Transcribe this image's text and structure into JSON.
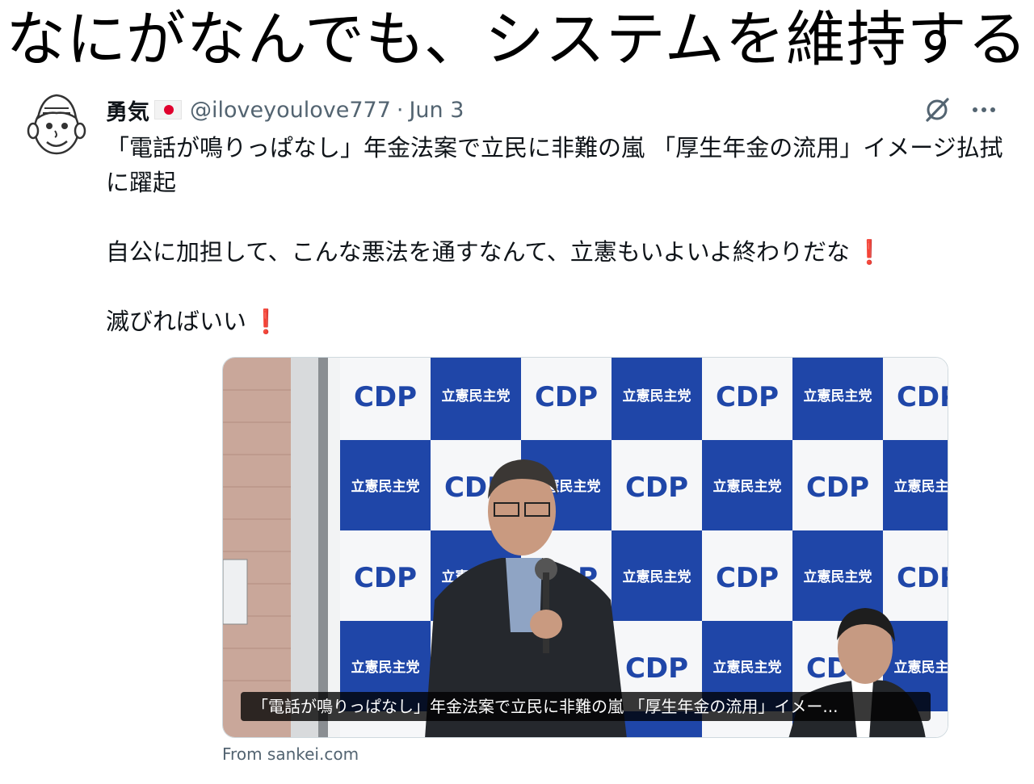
{
  "banner": {
    "title": "なにがなんでも、システムを維持する"
  },
  "tweet": {
    "display_name": "勇気",
    "handle": "@iloveyoulove777",
    "separator": "·",
    "date": "Jun 3",
    "text_line1": "「電話が鳴りっぱなし」年金法案で立民に非難の嵐 「厚生年金の流用」イメージ払拭に躍起",
    "text_line2": "自公に加担して、こんな悪法を通すなんて、立憲もいよいよ終わりだな",
    "text_line3": "滅びればいい",
    "exclamation": "❗"
  },
  "card": {
    "title": "「電話が鳴りっぱなし」年金法案で立民に非難の嵐 「厚生年金の流用」イメー...",
    "source": "From sankei.com",
    "backdrop_logo": "CDP",
    "backdrop_party": "立憲民主党"
  },
  "icons": {
    "avatar": "cartoon-face-avatar",
    "flag": "japan-flag-icon",
    "grok": "grok-icon",
    "more": "more-options-icon"
  },
  "colors": {
    "cdp_blue": "#1f46a8",
    "handle_gray": "#536471",
    "flag_red": "#e0002d",
    "exclamation_red": "#d6162b"
  }
}
